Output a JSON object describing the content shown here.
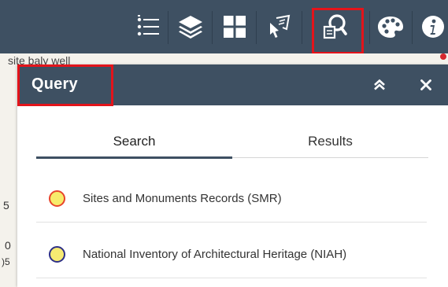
{
  "toolbar": {
    "tools": [
      {
        "icon": "layer-list-icon",
        "label": ""
      },
      {
        "icon": "layers-icon",
        "label": ""
      },
      {
        "icon": "basemap-gallery-icon",
        "label": ""
      },
      {
        "icon": "select-icon",
        "label": ""
      },
      {
        "icon": "query-icon",
        "label": "",
        "active": true
      },
      {
        "icon": "palette-icon",
        "label": ""
      },
      {
        "icon": "info-icon",
        "label": ""
      }
    ]
  },
  "map": {
    "top_text": "site   baly well",
    "side_glyphs": [
      "5",
      "0",
      ")5"
    ]
  },
  "panel": {
    "title": "Query",
    "tabs": [
      {
        "label": "Search",
        "active": true
      },
      {
        "label": "Results",
        "active": false
      }
    ],
    "layers": [
      {
        "label": "Sites and Monuments Records (SMR)",
        "fill": "#f7ec6b",
        "stroke": "#e8462c"
      },
      {
        "label": "National Inventory of Architectural Heritage (NIAH)",
        "fill": "#f6ea72",
        "stroke": "#2d2f86"
      }
    ]
  },
  "colors": {
    "header": "#3e5062",
    "highlight": "#e3141b",
    "icon": "#ffffff"
  }
}
